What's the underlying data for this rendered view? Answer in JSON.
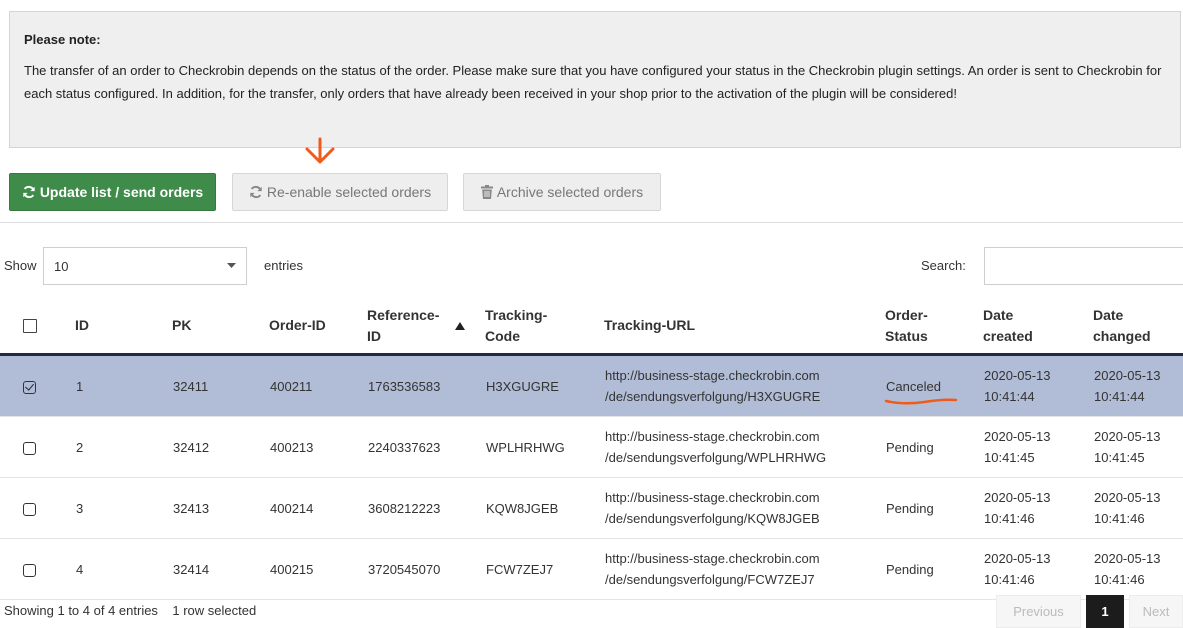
{
  "note": {
    "title": "Please note:",
    "text": "The transfer of an order to Checkrobin depends on the status of the order. Please make sure that you have configured your status in the Checkrobin plugin settings. An order is sent to Checkrobin for each status configured. In addition, for the transfer, only orders that have already been received in your shop prior to the activation of the plugin will be considered!"
  },
  "toolbar": {
    "update_label": "Update list / send orders",
    "reenable_label": "Re-enable selected orders",
    "archive_label": "Archive selected orders"
  },
  "controls": {
    "show_label": "Show",
    "entries_value": "10",
    "entries_label": "entries",
    "search_label": "Search:",
    "search_value": ""
  },
  "table": {
    "headers": {
      "id": "ID",
      "pk": "PK",
      "order_id": "Order-ID",
      "reference_id": "Reference-ID",
      "tracking_code": "Tracking-Code",
      "tracking_url": "Tracking-URL",
      "order_status": "Order-Status",
      "date_created": "Date created",
      "date_changed": "Date changed"
    },
    "rows": [
      {
        "id": "1",
        "pk": "32411",
        "order_id": "400211",
        "reference_id": "1763536583",
        "tracking_code": "H3XGUGRE",
        "url_line1": "http://business-stage.checkrobin.com",
        "url_line2": "/de/sendungsverfolgung/H3XGUGRE",
        "status": "Canceled",
        "created_date": "2020-05-13",
        "created_time": "10:41:44",
        "changed_date": "2020-05-13",
        "changed_time": "10:41:44",
        "selected": true
      },
      {
        "id": "2",
        "pk": "32412",
        "order_id": "400213",
        "reference_id": "2240337623",
        "tracking_code": "WPLHRHWG",
        "url_line1": "http://business-stage.checkrobin.com",
        "url_line2": "/de/sendungsverfolgung/WPLHRHWG",
        "status": "Pending",
        "created_date": "2020-05-13",
        "created_time": "10:41:45",
        "changed_date": "2020-05-13",
        "changed_time": "10:41:45",
        "selected": false
      },
      {
        "id": "3",
        "pk": "32413",
        "order_id": "400214",
        "reference_id": "3608212223",
        "tracking_code": "KQW8JGEB",
        "url_line1": "http://business-stage.checkrobin.com",
        "url_line2": "/de/sendungsverfolgung/KQW8JGEB",
        "status": "Pending",
        "created_date": "2020-05-13",
        "created_time": "10:41:46",
        "changed_date": "2020-05-13",
        "changed_time": "10:41:46",
        "selected": false
      },
      {
        "id": "4",
        "pk": "32414",
        "order_id": "400215",
        "reference_id": "3720545070",
        "tracking_code": "FCW7ZEJ7",
        "url_line1": "http://business-stage.checkrobin.com",
        "url_line2": "/de/sendungsverfolgung/FCW7ZEJ7",
        "status": "Pending",
        "created_date": "2020-05-13",
        "created_time": "10:41:46",
        "changed_date": "2020-05-13",
        "changed_time": "10:41:46",
        "selected": false
      }
    ]
  },
  "footer": {
    "info": "Showing 1 to 4 of 4 entries",
    "selected_info": "1 row selected",
    "prev_label": "Previous",
    "page_label": "1",
    "next_label": "Next"
  },
  "colors": {
    "update_button": "#3f8b49",
    "selected_row": "#b1bdd6",
    "annotation": "#f05a1a"
  },
  "icons": {
    "update": "refresh-icon",
    "reenable": "refresh-icon",
    "archive": "trash-icon",
    "select": "chevron-down-icon",
    "sort": "sort-asc-icon"
  }
}
